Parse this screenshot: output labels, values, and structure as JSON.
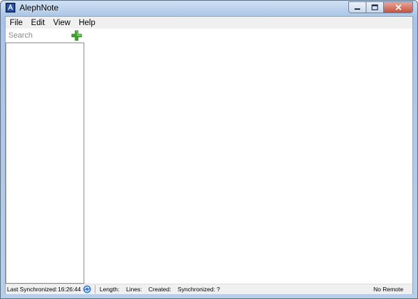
{
  "window": {
    "title": "AlephNote",
    "icon": "alephnote-app-icon"
  },
  "caption_buttons": {
    "minimize": "minimize-icon",
    "maximize": "maximize-icon",
    "close": "close-icon"
  },
  "menu": {
    "items": [
      {
        "label": "File"
      },
      {
        "label": "Edit"
      },
      {
        "label": "View"
      },
      {
        "label": "Help"
      }
    ]
  },
  "search": {
    "placeholder": "Search",
    "value": ""
  },
  "add_note": {
    "icon": "plus-icon",
    "color": "#3fa52a"
  },
  "status": {
    "last_sync_label": "Last Synchronized:",
    "last_sync_time": "16:26:44",
    "length_label": "Length:",
    "lines_label": "Lines:",
    "created_label": "Created:",
    "synchronized_label": "Synchronized:",
    "synchronized_value": "?",
    "remote_label": "No Remote"
  }
}
